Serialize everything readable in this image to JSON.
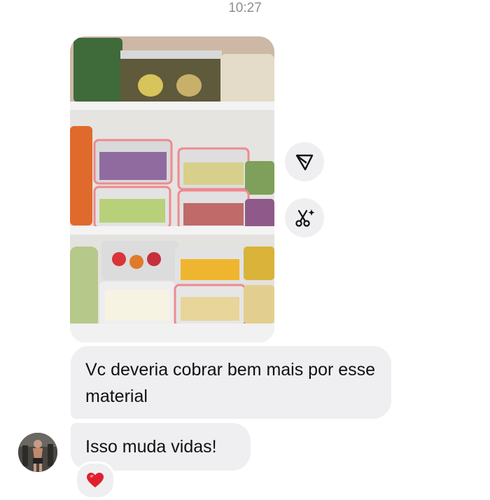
{
  "header": {
    "time": "10:27"
  },
  "photo": {
    "icon": "food-containers-fridge-photo"
  },
  "actions": [
    {
      "icon": "share-icon"
    },
    {
      "icon": "sparkle-scissors-icon"
    }
  ],
  "messages": [
    {
      "text": "Vc deveria cobrar bem mais por esse material"
    },
    {
      "text": "Isso muda vidas!"
    }
  ],
  "reaction": {
    "emoji": "❤️",
    "color": "#e0202e"
  },
  "colors": {
    "bubble": "#efeff1",
    "timestamp": "#8e8e93"
  }
}
